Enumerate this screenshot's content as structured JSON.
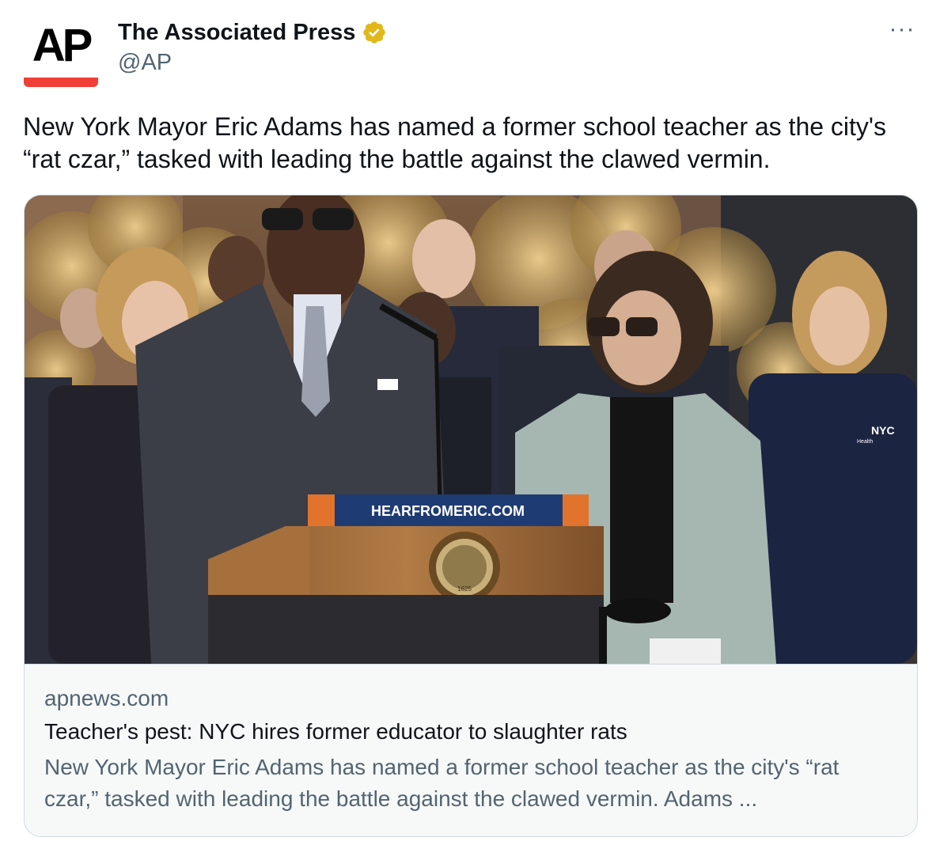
{
  "author": {
    "avatar_text": "AP",
    "display_name": "The Associated Press",
    "handle": "@AP",
    "verified_icon": "verified-gold-badge-icon",
    "more_icon": "more-options-icon",
    "more_label": "···"
  },
  "tweet": {
    "text": "New York Mayor Eric Adams has named a former school teacher as the city's “rat czar,” tasked with leading the battle against the clawed vermin."
  },
  "card": {
    "image": {
      "podium_sign": "HEARFROMERIC.COM",
      "shirt_logo": "NYC",
      "shirt_logo_sub": "Health",
      "seal_year": "1625"
    },
    "domain": "apnews.com",
    "title": "Teacher's pest: NYC hires former educator to slaughter rats",
    "description": "New York Mayor Eric Adams has named a former school teacher as the city's “rat czar,” tasked with leading the battle against the clawed vermin. Adams ..."
  },
  "colors": {
    "ap_red": "#ef3f36",
    "verified_gold": "#e2b719",
    "secondary_text": "#536471",
    "border": "#cfd9de"
  }
}
